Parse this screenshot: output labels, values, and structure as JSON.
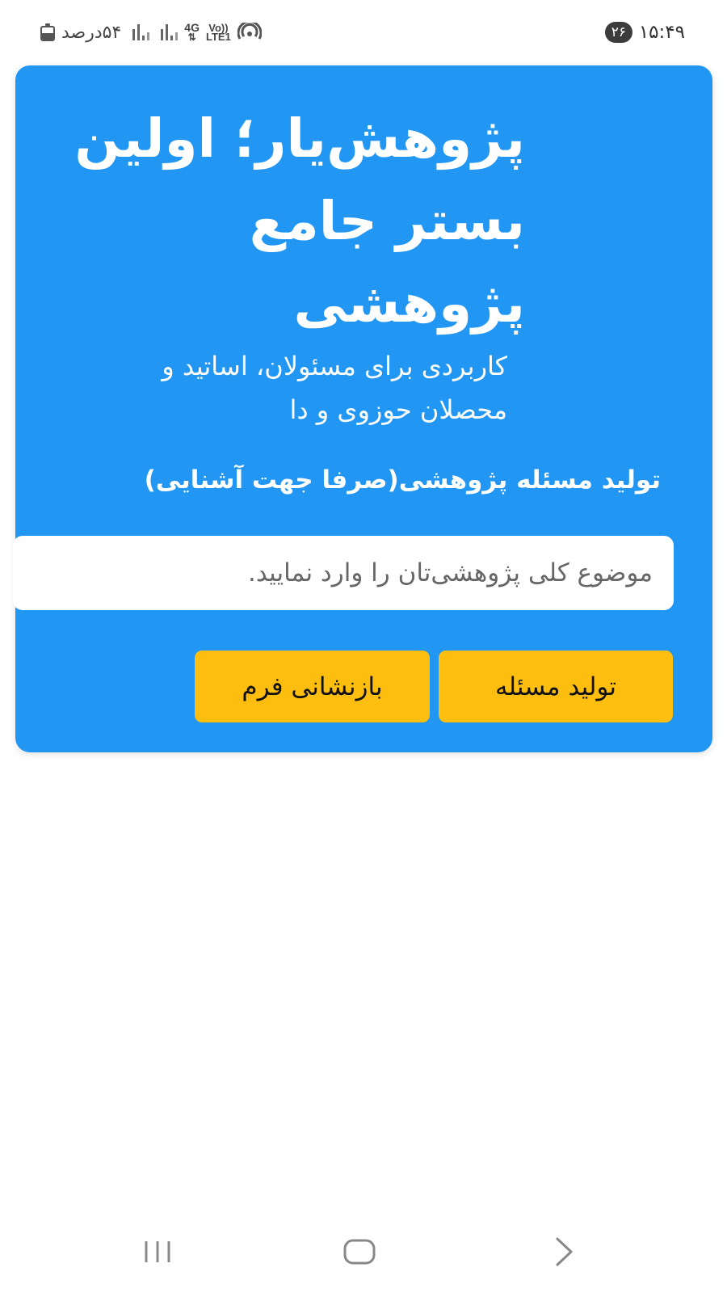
{
  "status_bar": {
    "battery_text": "۵۴درصد",
    "battery_level": 0.54,
    "network_label": "4G",
    "volte_label_top": "Vo))",
    "volte_label_bottom": "LTE1",
    "notification_count": "۲۶",
    "clock": "۱۵:۴۹",
    "icons": [
      "battery-icon",
      "signal-icon",
      "signal-icon",
      "network-4g-icon",
      "volte-icon",
      "hotspot-icon"
    ]
  },
  "hero": {
    "title": "پژوهش‌یار؛ اولین بستر جامع پژوهشی",
    "subtitle": "کاربردی برای مسئولان، اساتید و محصلان حوزوی و دا",
    "section_label": "تولید مسئله پژوهشی(صرفا جهت آشنایی)",
    "input_placeholder": "موضوع کلی پژوهشی‌تان را وارد نمایید.",
    "input_value": "",
    "generate_button": "تولید مسئله",
    "reset_button": "بازنشانی فرم"
  },
  "nav_bar": {
    "icons": [
      "recent-apps-icon",
      "home-icon",
      "back-icon"
    ]
  },
  "colors": {
    "card": "#2196f3",
    "button": "#fdbe10",
    "text_on_card": "#ffffff"
  }
}
